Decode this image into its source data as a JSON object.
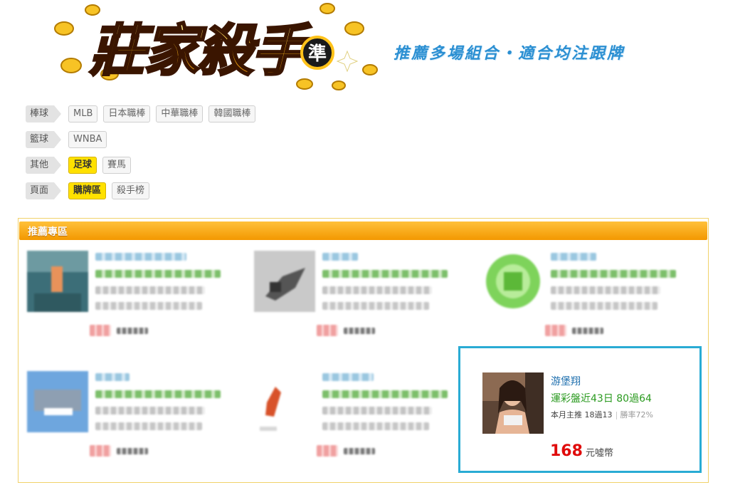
{
  "header": {
    "logo_text": "莊家殺手",
    "logo_badge": "準",
    "slogan": "推薦多場組合・適合均注跟牌"
  },
  "filters": [
    {
      "category": "棒球",
      "items": [
        {
          "label": "MLB",
          "active": false
        },
        {
          "label": "日本職棒",
          "active": false
        },
        {
          "label": "中華職棒",
          "active": false
        },
        {
          "label": "韓國職棒",
          "active": false
        }
      ]
    },
    {
      "category": "籃球",
      "items": [
        {
          "label": "WNBA",
          "active": false
        }
      ]
    },
    {
      "category": "其他",
      "items": [
        {
          "label": "足球",
          "active": true
        },
        {
          "label": "賽馬",
          "active": false
        }
      ]
    },
    {
      "category": "頁面",
      "items": [
        {
          "label": "購牌區",
          "active": true
        },
        {
          "label": "殺手榜",
          "active": false
        }
      ]
    }
  ],
  "recommend": {
    "title": "推薦專區",
    "highlighted_card": {
      "name": "游堡翔",
      "record": "運彩盤近43日 80過64",
      "monthly_main": "本月主推 18過13",
      "win_rate": "勝率72%",
      "price": "168",
      "price_unit": "元噓幣"
    }
  },
  "colors": {
    "accent_orange": "#f39800",
    "active_chip": "#ffe100",
    "highlight_border": "#29abd4",
    "price_red": "#e00b0b",
    "record_green": "#2a9a1f",
    "name_blue": "#1e6fae"
  }
}
